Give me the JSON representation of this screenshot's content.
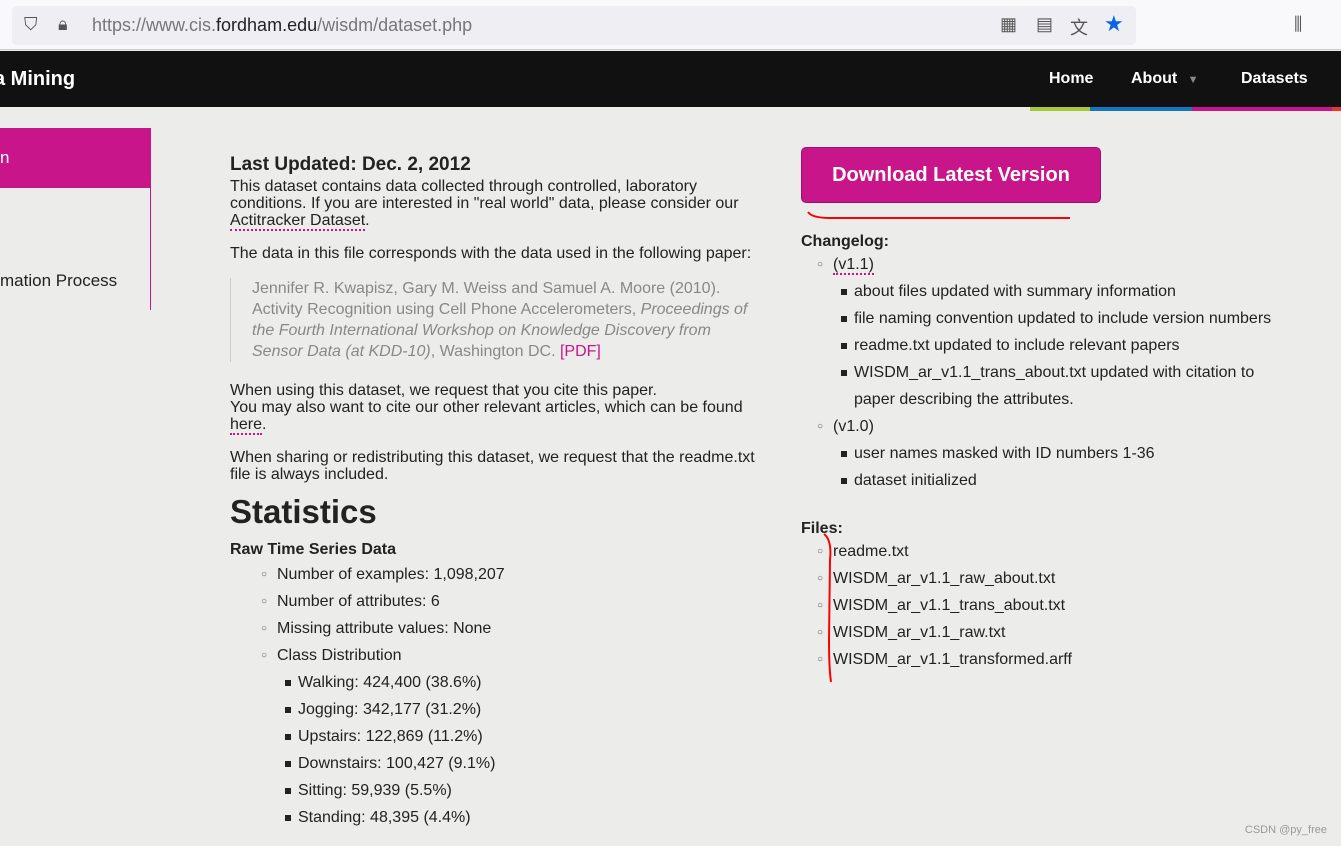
{
  "browser": {
    "url_prefix": "https://www.cis.",
    "url_domain": "fordham.edu",
    "url_suffix": "/wisdm/dataset.php"
  },
  "nav": {
    "brand": "a Mining",
    "items": [
      {
        "label": "Home"
      },
      {
        "label": "About"
      },
      {
        "label": "Datasets"
      }
    ]
  },
  "sidebar": {
    "active": "n",
    "item": "mation Process"
  },
  "main": {
    "updated": "Last Updated: Dec. 2, 2012",
    "p1": "This dataset contains data collected through controlled, laboratory conditions. If you are interested in \"real world\" data, please consider our ",
    "p1_link": "Actitracker Dataset",
    "p2": "The data in this file corresponds with the data used in the following paper:",
    "cite": "Jennifer R. Kwapisz, Gary M. Weiss and Samuel A. Moore (2010). Activity Recognition using Cell Phone Accelerometers, ",
    "cite_italic": "Proceedings of the Fourth International Workshop on Knowledge Discovery from Sensor Data (at KDD-10)",
    "cite_end": ", Washington DC. ",
    "pdf": "[PDF]",
    "p3a": "When using this dataset, we request that you cite this paper.",
    "p3b": "You may also want to cite our other relevant articles, which can be found ",
    "here": "here",
    "p4": "When sharing or redistributing this dataset, we request that the readme.txt file is always included.",
    "stats_title": "Statistics",
    "raw_title": "Raw Time Series Data",
    "stats": [
      "Number of examples: 1,098,207",
      "Number of attributes: 6",
      "Missing attribute values: None",
      "Class Distribution"
    ],
    "classes": [
      "Walking: 424,400 (38.6%)",
      "Jogging: 342,177 (31.2%)",
      "Upstairs: 122,869 (11.2%)",
      "Downstairs: 100,427 (9.1%)",
      "Sitting: 59,939 (5.5%)",
      "Standing: 48,395 (4.4%)"
    ]
  },
  "right": {
    "download": "Download Latest Version",
    "changelog": "Changelog:",
    "v11": "(v1.1)",
    "v11_items": [
      "about files updated with summary information",
      "file naming convention updated to include version numbers",
      "readme.txt updated to include relevant papers",
      "WISDM_ar_v1.1_trans_about.txt updated with citation to paper describing the attributes."
    ],
    "v10": "(v1.0)",
    "v10_items": [
      "user names masked with ID numbers 1-36",
      "dataset initialized"
    ],
    "files_title": "Files:",
    "files": [
      "readme.txt",
      "WISDM_ar_v1.1_raw_about.txt",
      "WISDM_ar_v1.1_trans_about.txt",
      "WISDM_ar_v1.1_raw.txt",
      "WISDM_ar_v1.1_transformed.arff"
    ]
  },
  "watermark": "CSDN @py_free",
  "colors": {
    "accent": "#c8168a",
    "green": "#a6c93a",
    "blue": "#1577c0",
    "red": "#e8362d",
    "annotation": "#ff0000"
  }
}
